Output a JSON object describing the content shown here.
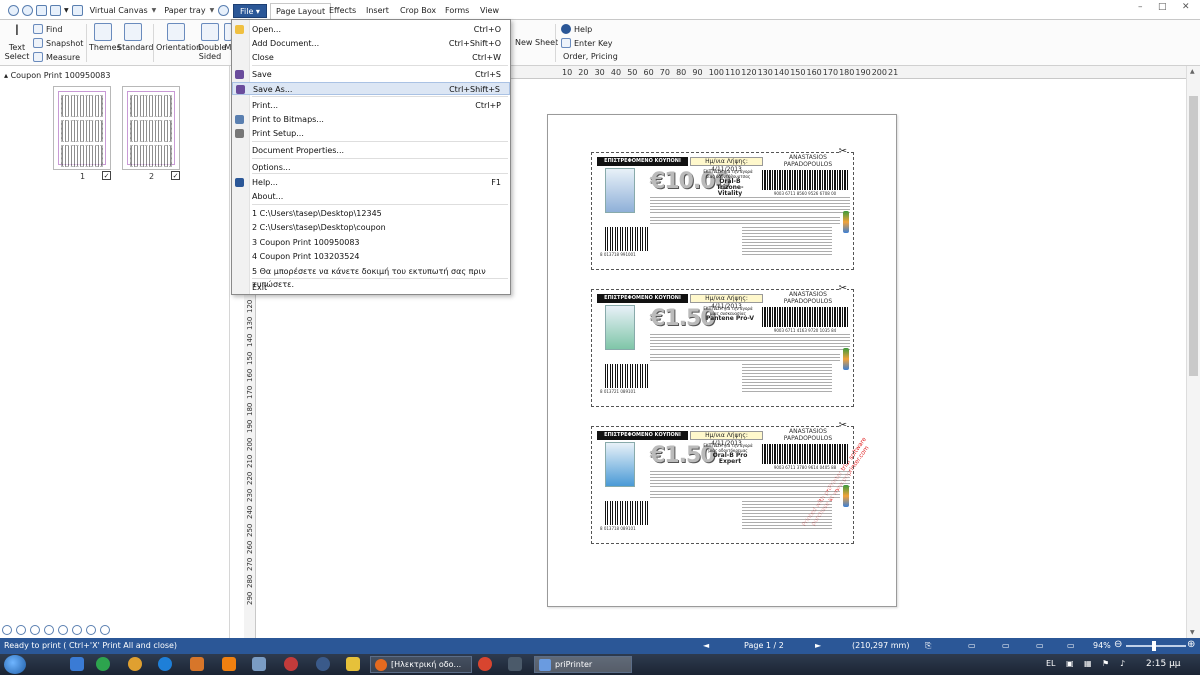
{
  "quick_access": {
    "canvas_label": "Virtual Canvas",
    "tray_label": "Paper tray"
  },
  "tabs": {
    "file": "File",
    "page_layout": "Page Layout",
    "effects": "Effects",
    "insert": "Insert",
    "crop_box": "Crop Box",
    "forms": "Forms",
    "view": "View"
  },
  "ribbon": {
    "text_select": "Text",
    "text_select2": "Select",
    "find": "Find",
    "snapshot": "Snapshot",
    "measure": "Measure",
    "themes": "Themes",
    "standard": "Standard",
    "orientation": "Orientation",
    "double_sided": "Double",
    "double_sided2": "Sided",
    "cut_m": "M",
    "new_sheet": "New Sheet",
    "help": "Help",
    "enter_key": "Enter Key",
    "order_pricing": "Order, Pricing"
  },
  "left_panel": {
    "title": "Coupon Print 100950083",
    "thumbs": [
      {
        "num": "1",
        "check": "✓"
      },
      {
        "num": "2",
        "check": "✓"
      }
    ]
  },
  "ruler_top": [
    "10",
    "20",
    "30",
    "40",
    "50",
    "60",
    "70",
    "80",
    "90",
    "100",
    "110",
    "120",
    "130",
    "140",
    "150",
    "160",
    "170",
    "180",
    "190",
    "200",
    "21"
  ],
  "ruler_left": [
    "120",
    "130",
    "140",
    "150",
    "160",
    "170",
    "180",
    "190",
    "200",
    "210",
    "220",
    "230",
    "240",
    "250",
    "260",
    "270",
    "280",
    "290"
  ],
  "file_menu": {
    "items": [
      {
        "label": "Open...",
        "shortcut": "Ctrl+O",
        "icon_color": "#f0c040"
      },
      {
        "label": "Add Document...",
        "shortcut": "Ctrl+Shift+O",
        "icon_color": ""
      },
      {
        "label": "Close",
        "shortcut": "Ctrl+W",
        "icon_color": ""
      },
      {
        "label": "Save",
        "shortcut": "Ctrl+S",
        "icon_color": "#6a4c9c"
      },
      {
        "label": "Save As...",
        "shortcut": "Ctrl+Shift+S",
        "icon_color": "#6a4c9c"
      },
      {
        "label": "Print...",
        "shortcut": "Ctrl+P",
        "icon_color": ""
      },
      {
        "label": "Print to Bitmaps...",
        "shortcut": "",
        "icon_color": "#5a7fb0"
      },
      {
        "label": "Print Setup...",
        "shortcut": "",
        "icon_color": "#777777"
      },
      {
        "label": "Document Properties...",
        "shortcut": "",
        "icon_color": ""
      },
      {
        "label": "Options...",
        "shortcut": "",
        "icon_color": ""
      },
      {
        "label": "Help...",
        "shortcut": "F1",
        "icon_color": "#2b5797"
      },
      {
        "label": "About...",
        "shortcut": "",
        "icon_color": ""
      },
      {
        "label": "1 C:\\Users\\tasep\\Desktop\\12345",
        "shortcut": "",
        "icon_color": ""
      },
      {
        "label": "2 C:\\Users\\tasep\\Desktop\\coupon",
        "shortcut": "",
        "icon_color": ""
      },
      {
        "label": "3 Coupon Print 100950083",
        "shortcut": "",
        "icon_color": ""
      },
      {
        "label": "4 Coupon Print 103203524",
        "shortcut": "",
        "icon_color": ""
      },
      {
        "label": "5 Θα μπορέσετε να κάνετε δοκιμή του εκτυπωτή σας πριν τυπώσετε.",
        "shortcut": "",
        "icon_color": ""
      },
      {
        "label": "Exit",
        "shortcut": "",
        "icon_color": ""
      }
    ]
  },
  "coupons": [
    {
      "header": "ΕΠΙΣΤΡΕΦΟΜΕΝΟ ΚΟΥΠΟΝΙ",
      "date": "Ημ/νια Λήψης: 4/11/2013",
      "name1": "ANASTASIOS",
      "name2": "PAPADOPOULOS",
      "price": "€10.00",
      "offer": "ΕΚΠΤΩΣΗ για την αγορά μιας οδοντόβουρτσας",
      "brand1": "Oral-B",
      "brand2": "Trizone-Vitality",
      "barcode_top": "9003 6711 8560 9526 6708 00",
      "barcode_bottom": "8 013718 991001",
      "product_color": "#8fb0d8"
    },
    {
      "header": "ΕΠΙΣΤΡΕΦΟΜΕΝΟ ΚΟΥΠΟΝΙ",
      "date": "Ημ/νια Λήψης: 4/11/2013",
      "name1": "ANASTASIOS",
      "name2": "PAPADOPOULOS",
      "price": "€1.50",
      "offer": "ΕΚΠΤΩΣΗ για την αγορά μιας συσκευασίας",
      "brand1": "Pantene Pro-V",
      "brand2": "",
      "barcode_top": "9003 6711 4163 9720 1035 84",
      "barcode_bottom": "8 013721 089101",
      "product_color": "#7fc6a8"
    },
    {
      "header": "ΕΠΙΣΤΡΕΦΟΜΕΝΟ ΚΟΥΠΟΝΙ",
      "date": "Ημ/νια Λήψης: 4/11/2013",
      "name1": "ANASTASIOS",
      "name2": "PAPADOPOULOS",
      "price": "€1.50",
      "offer": "ΕΚΠΤΩΣΗ για την αγορά μιας οδοντόκρεμας",
      "brand1": "Oral-B Pro Expert",
      "brand2": "",
      "barcode_top": "9003 6711 3780 9614 0405 88",
      "barcode_bottom": "8 013718 089101",
      "product_color": "#4a9ad6"
    }
  ],
  "watermark": "Printed with priPrinter trial software purchase at www.priprinter.com",
  "status": {
    "left": "Ready to print ( Ctrl+'X' Print All and close)",
    "page": "Page 1 / 2",
    "size": "(210,297 mm)",
    "zoom": "94%"
  },
  "taskbar": {
    "btn1": "[Ηλεκτρική οδο...",
    "btn2": "priPrinter",
    "lang": "EL",
    "time": "2:15 μμ"
  },
  "colors": {
    "accent": "#2b5797",
    "coupon_header": "#111111",
    "watermark": "#e02020"
  }
}
